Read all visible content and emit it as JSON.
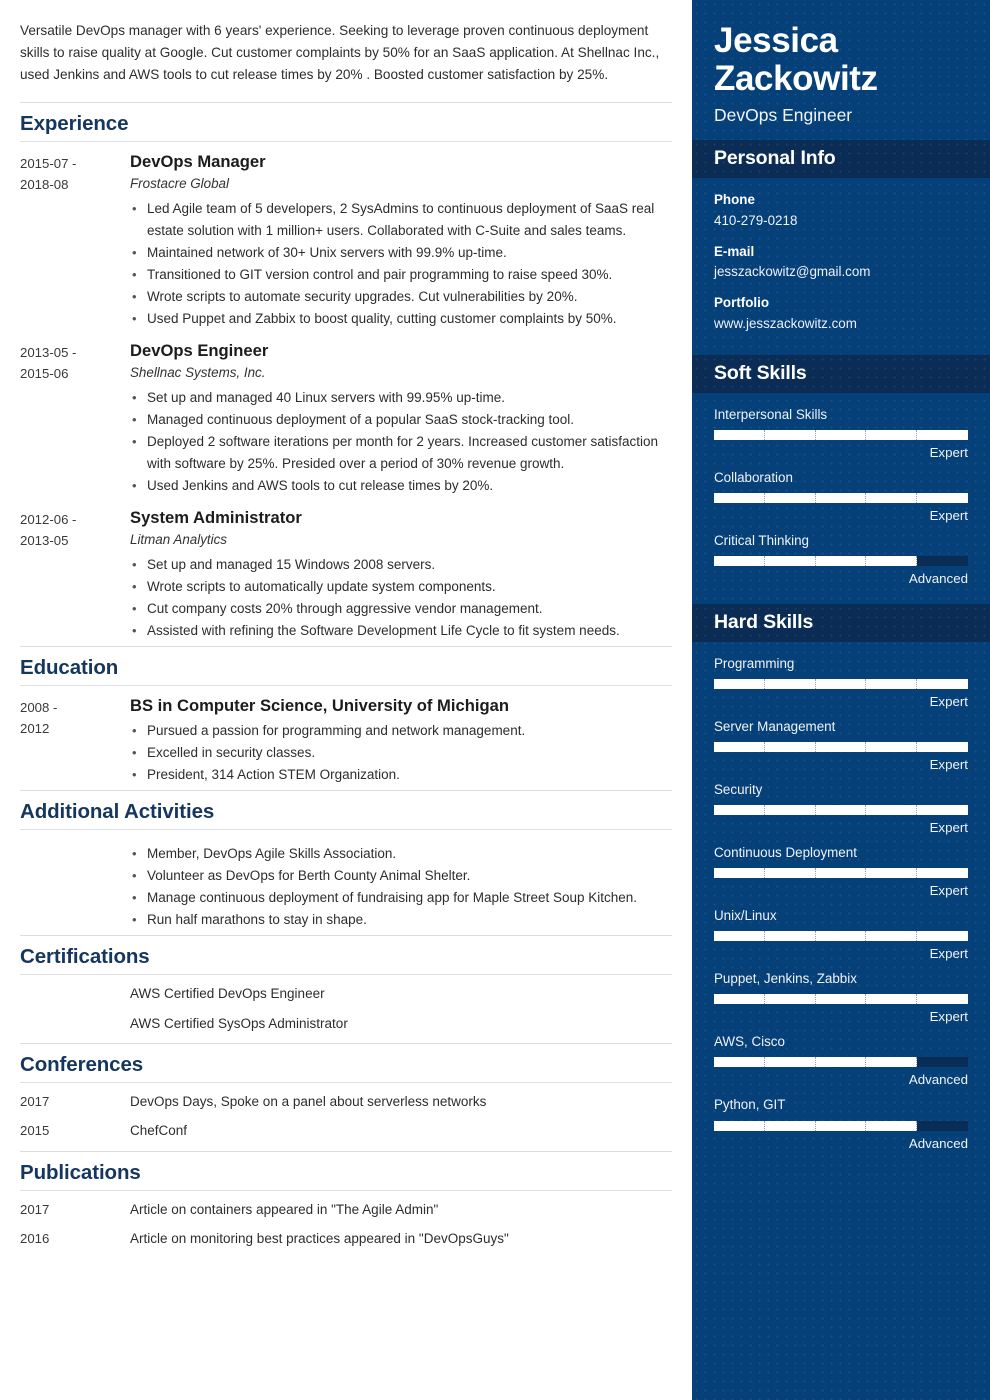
{
  "summary": "Versatile DevOps manager with 6 years' experience. Seeking to leverage proven continuous deployment skills to raise quality at Google. Cut customer complaints by 50% for an SaaS application. At Shellnac Inc., used Jenkins and AWS tools to cut release times by 20% . Boosted customer satisfaction by 25%.",
  "sections": {
    "experience": {
      "title": "Experience",
      "entries": [
        {
          "dates": "2015-07 - 2018-08",
          "role": "DevOps Manager",
          "org": "Frostacre Global",
          "bullets": [
            "Led Agile team of 5 developers, 2 SysAdmins to continuous deployment of SaaS real estate solution with 1 million+ users. Collaborated with C-Suite and sales teams.",
            "Maintained network of 30+ Unix servers with 99.9% up-time.",
            "Transitioned to GIT version control and pair programming to raise speed 30%.",
            "Wrote scripts to automate security upgrades. Cut vulnerabilities by 20%.",
            "Used Puppet and Zabbix to boost quality, cutting customer complaints by 50%."
          ]
        },
        {
          "dates": "2013-05 - 2015-06",
          "role": "DevOps Engineer",
          "org": "Shellnac Systems, Inc.",
          "bullets": [
            "Set up and managed 40 Linux servers with 99.95% up-time.",
            "Managed continuous deployment of a popular SaaS stock-tracking tool.",
            "Deployed 2 software iterations per month for 2 years. Increased customer satisfaction with software by 25%. Presided over a period of 30% revenue growth.",
            "Used Jenkins and AWS tools to cut release times by 20%."
          ]
        },
        {
          "dates": "2012-06 - 2013-05",
          "role": "System Administrator",
          "org": "Litman Analytics",
          "bullets": [
            "Set up and managed 15 Windows 2008 servers.",
            "Wrote scripts to automatically update system components.",
            "Cut company costs 20% through aggressive vendor management.",
            "Assisted with refining the Software Development Life Cycle to fit system needs."
          ]
        }
      ]
    },
    "education": {
      "title": "Education",
      "entries": [
        {
          "dates": "2008 - 2012",
          "role": "BS in Computer Science, University of Michigan",
          "org": "",
          "bullets": [
            "Pursued a passion for programming and network management.",
            "Excelled in security classes.",
            "President, 314 Action STEM Organization."
          ]
        }
      ]
    },
    "additional_activities": {
      "title": "Additional Activities",
      "entries": [
        {
          "dates": "",
          "role": "",
          "org": "",
          "bullets": [
            "Member, DevOps Agile Skills Association.",
            "Volunteer as DevOps for Berth County Animal Shelter.",
            "Manage continuous deployment of fundraising app for Maple Street Soup Kitchen.",
            "Run half marathons to stay in shape."
          ]
        }
      ]
    },
    "certifications": {
      "title": "Certifications",
      "rows": [
        {
          "date": "",
          "text": "AWS Certified DevOps Engineer"
        },
        {
          "date": "",
          "text": "AWS Certified SysOps Administrator"
        }
      ]
    },
    "conferences": {
      "title": "Conferences",
      "rows": [
        {
          "date": "2017",
          "text": "DevOps Days, Spoke on a panel about serverless networks"
        },
        {
          "date": "2015",
          "text": "ChefConf"
        }
      ]
    },
    "publications": {
      "title": "Publications",
      "rows": [
        {
          "date": "2017",
          "text": "Article on containers appeared in \"The Agile Admin\""
        },
        {
          "date": "2016",
          "text": "Article on monitoring best practices appeared in \"DevOpsGuys\""
        }
      ]
    }
  },
  "sidebar": {
    "name": "Jessica Zackowitz",
    "job_title": "DevOps Engineer",
    "personal_info": {
      "heading": "Personal Info",
      "items": [
        {
          "label": "Phone",
          "value": "410-279-0218"
        },
        {
          "label": "E-mail",
          "value": "jesszackowitz@gmail.com"
        },
        {
          "label": "Portfolio",
          "value": "www.jesszackowitz.com"
        }
      ]
    },
    "soft_skills": {
      "heading": "Soft Skills",
      "items": [
        {
          "name": "Interpersonal Skills",
          "level": "Expert",
          "percent": 100
        },
        {
          "name": "Collaboration",
          "level": "Expert",
          "percent": 100
        },
        {
          "name": "Critical Thinking",
          "level": "Advanced",
          "percent": 80
        }
      ]
    },
    "hard_skills": {
      "heading": "Hard Skills",
      "items": [
        {
          "name": "Programming",
          "level": "Expert",
          "percent": 100
        },
        {
          "name": "Server Management",
          "level": "Expert",
          "percent": 100
        },
        {
          "name": "Security",
          "level": "Expert",
          "percent": 100
        },
        {
          "name": "Continuous Deployment",
          "level": "Expert",
          "percent": 100
        },
        {
          "name": "Unix/Linux",
          "level": "Expert",
          "percent": 100
        },
        {
          "name": "Puppet, Jenkins, Zabbix",
          "level": "Expert",
          "percent": 100
        },
        {
          "name": "AWS, Cisco",
          "level": "Advanced",
          "percent": 80
        },
        {
          "name": "Python, GIT",
          "level": "Advanced",
          "percent": 80
        }
      ]
    }
  },
  "colors": {
    "sidebar_bg": "#064079",
    "sidebar_band_bg": "#0b2c55",
    "heading_navy": "#15365e",
    "bar_fill": "#ffffff",
    "bar_track": "#0a2d56",
    "body_text": "#2d2d2d"
  }
}
